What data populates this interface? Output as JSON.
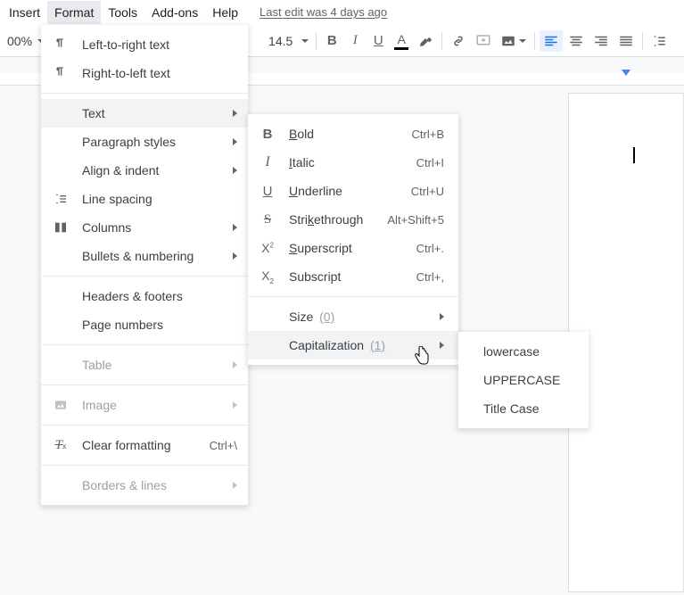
{
  "menubar": {
    "items": [
      "Insert",
      "Format",
      "Tools",
      "Add-ons",
      "Help"
    ],
    "last_edit": "Last edit was 4 days ago"
  },
  "toolbar": {
    "zoom": "00%",
    "font_size": "14.5"
  },
  "format_menu": {
    "ltr": "Left-to-right text",
    "rtl": "Right-to-left text",
    "text": "Text",
    "para": "Paragraph styles",
    "align": "Align & indent",
    "line": "Line spacing",
    "cols": "Columns",
    "bullets": "Bullets & numbering",
    "headers": "Headers & footers",
    "pagenum": "Page numbers",
    "table": "Table",
    "image": "Image",
    "clear": "Clear formatting",
    "clear_short": "Ctrl+\\",
    "borders": "Borders & lines"
  },
  "text_menu": {
    "bold": {
      "label": "Bold",
      "key": "B",
      "short": "Ctrl+B"
    },
    "italic": {
      "label": "Italic",
      "key": "I",
      "short": "Ctrl+I"
    },
    "underline": {
      "label": "Underline",
      "key": "U",
      "short": "Ctrl+U"
    },
    "strike": {
      "label": "Strikethrough",
      "pre": "Stri",
      "key": "k",
      "post": "ethrough",
      "short": "Alt+Shift+5"
    },
    "super": {
      "label": "Superscript",
      "key": "S",
      "short": "Ctrl+."
    },
    "sub": {
      "label": "Subscript",
      "short": "Ctrl+,"
    },
    "size": {
      "label": "Size",
      "hint": "(0)"
    },
    "cap": {
      "label": "Capitalization",
      "hint": "(1)"
    }
  },
  "cap_menu": {
    "lower": "lowercase",
    "upper": "UPPERCASE",
    "title": "Title Case"
  }
}
